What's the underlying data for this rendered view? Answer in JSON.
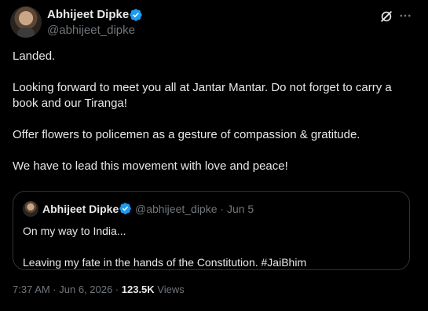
{
  "author": {
    "name": "Abhijeet Dipke",
    "handle": "@abhijeet_dipke"
  },
  "post": {
    "paragraphs": [
      "Landed.",
      "Looking forward to meet you all at Jantar Mantar. Do not forget to carry a book and our Tiranga!",
      "Offer flowers to policemen as a gesture of compassion & gratitude.",
      "We have to lead this movement with love and peace!"
    ]
  },
  "quoted_post": {
    "name": "Abhijeet Dipke",
    "handle_and_date": "@abhijeet_dipke · Jun 5",
    "lines": [
      "On my way to India...",
      "Leaving my fate in the hands of the Constitution. #JaiBhim"
    ]
  },
  "meta": {
    "time_date": "7:37 AM · Jun 6, 2026 · ",
    "views_count": "123.5K",
    "views_label": " Views"
  },
  "icons": {
    "verified": "verified-badge-icon",
    "grok": "grok-icon",
    "more": "more-options-icon"
  },
  "colors": {
    "background": "#000000",
    "text": "#e7e9ea",
    "secondary": "#71767b",
    "verified": "#1d9bf0",
    "border": "#2f3336"
  }
}
